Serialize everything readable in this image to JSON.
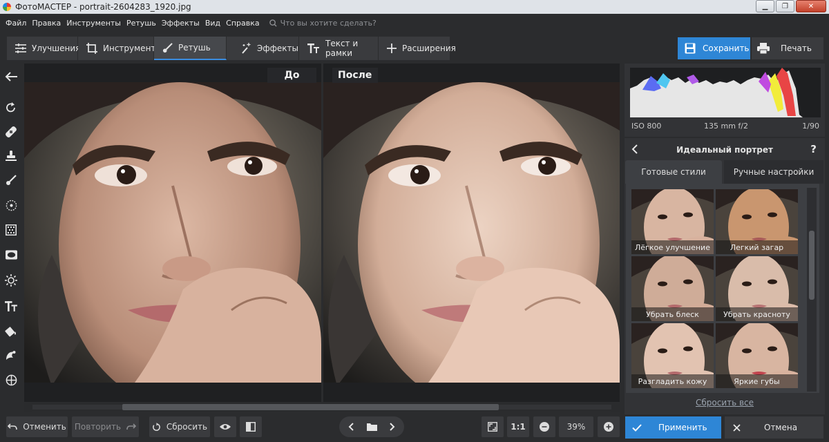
{
  "window": {
    "title": "ФотоМАСТЕР - portrait-2604283_1920.jpg"
  },
  "menu": {
    "items": [
      "Файл",
      "Правка",
      "Инструменты",
      "Ретушь",
      "Эффекты",
      "Вид",
      "Справка"
    ],
    "search_placeholder": "Что вы хотите сделать?"
  },
  "toolbar": {
    "tabs": [
      {
        "label": "Улучшения",
        "icon": "sliders-icon"
      },
      {
        "label": "Инструменты",
        "icon": "crop-icon"
      },
      {
        "label": "Ретушь",
        "icon": "brush-icon",
        "active": true
      },
      {
        "label": "Эффекты",
        "icon": "magic-wand-icon"
      },
      {
        "label": "Текст и рамки",
        "icon": "text-icon"
      },
      {
        "label": "Расширения",
        "icon": "plus-icon"
      }
    ],
    "save_label": "Сохранить",
    "print_label": "Печать"
  },
  "canvas": {
    "before_label": "До",
    "after_label": "После"
  },
  "histogram": {
    "iso": "ISO 800",
    "lens": "135 mm f/2",
    "shutter": "1/90"
  },
  "panel": {
    "title": "Идеальный портрет",
    "help": "?",
    "tabs": [
      "Готовые стили",
      "Ручные настройки"
    ],
    "presets": [
      "Лёгкое улучшение",
      "Легкий загар",
      "Убрать блеск",
      "Убрать красноту",
      "Разгладить кожу",
      "Яркие губы"
    ],
    "reset_all": "Сбросить все"
  },
  "bottom": {
    "undo": "Отменить",
    "redo": "Повторить",
    "reset": "Сбросить",
    "zoom_1to1": "1:1",
    "zoom": "39%",
    "apply": "Применить",
    "cancel": "Отмена"
  },
  "colors": {
    "accent": "#2e86d6",
    "background": "#2b2c2e",
    "panel": "#323336"
  }
}
